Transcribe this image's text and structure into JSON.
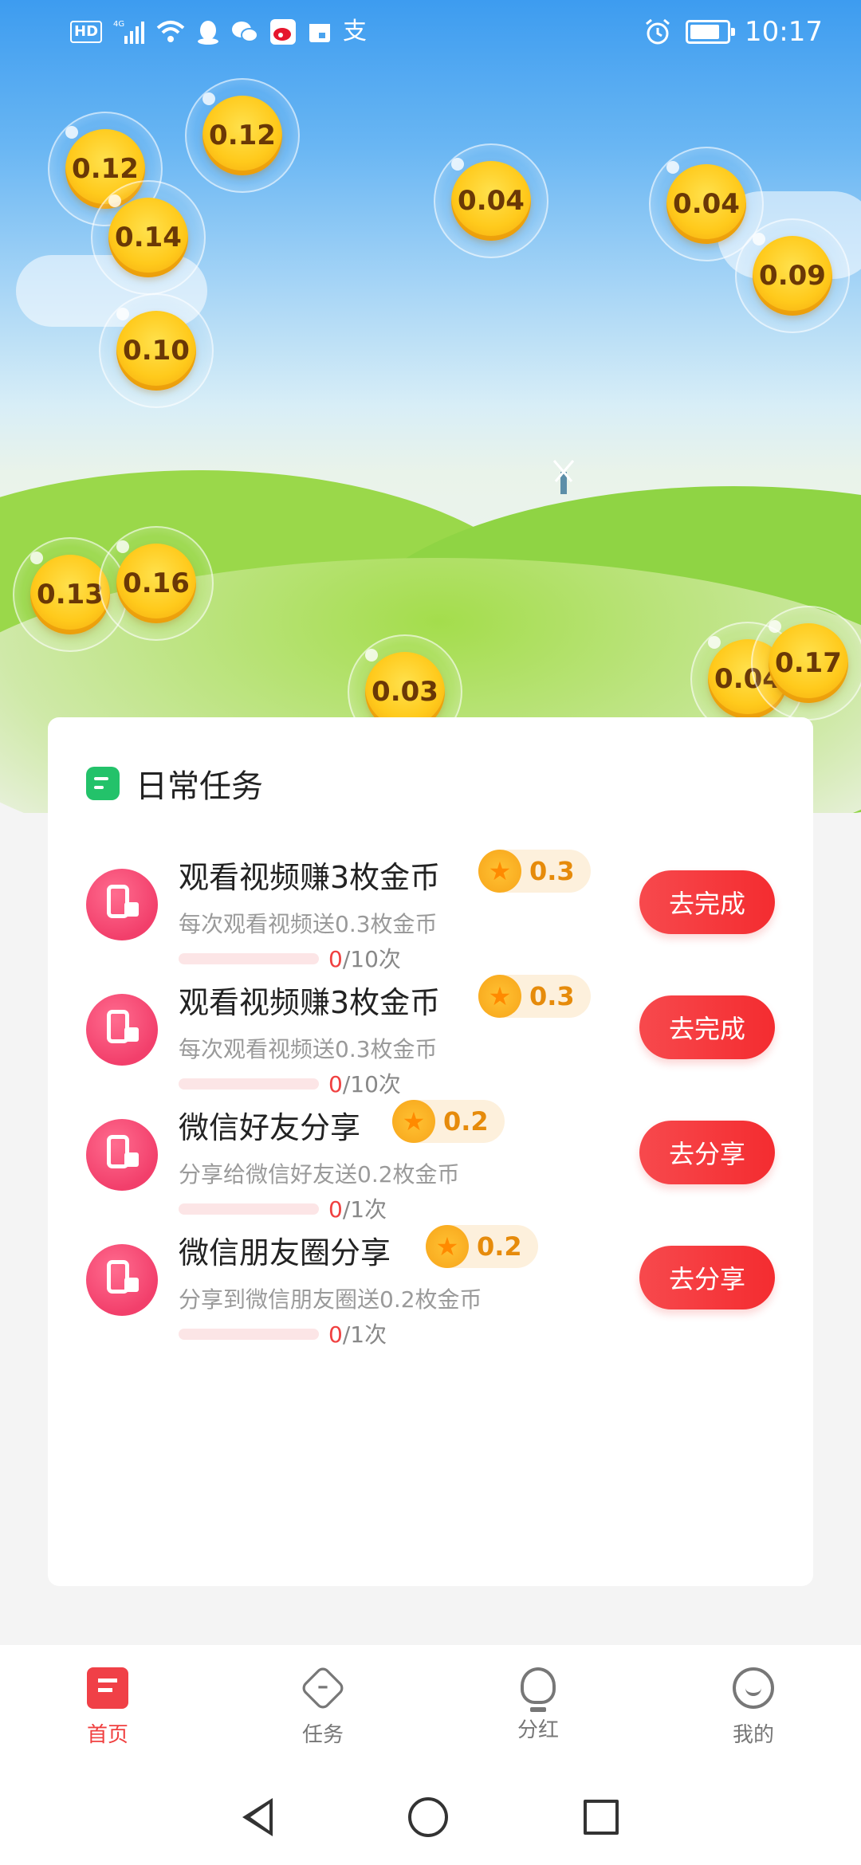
{
  "status_bar": {
    "time": "10:17",
    "left_icons": [
      "hd-icon",
      "signal-4g-icon",
      "wifi-icon",
      "qq-icon",
      "wechat-icon",
      "weibo-icon",
      "calendar-icon",
      "alipay-icon"
    ],
    "right_icons": [
      "alarm-icon",
      "battery-icon"
    ]
  },
  "coins": [
    "0.12",
    "0.12",
    "0.14",
    "0.10",
    "0.04",
    "0.04",
    "0.09",
    "0.13",
    "0.16",
    "0.03",
    "0.04",
    "0.17"
  ],
  "daily_tasks": {
    "title": "日常任务",
    "tasks": [
      {
        "title": "观看视频赚3枚金币",
        "reward": "0.3",
        "desc": "每次观看视频送0.3枚金币",
        "done": "0",
        "total": "/10次",
        "progress": 0,
        "button": "去完成"
      },
      {
        "title": "观看视频赚3枚金币",
        "reward": "0.3",
        "desc": "每次观看视频送0.3枚金币",
        "done": "0",
        "total": "/10次",
        "progress": 0,
        "button": "去完成"
      },
      {
        "title": "微信好友分享",
        "reward": "0.2",
        "desc": "分享给微信好友送0.2枚金币",
        "done": "0",
        "total": "/1次",
        "progress": 0,
        "button": "去分享"
      },
      {
        "title": "微信朋友圈分享",
        "reward": "0.2",
        "desc": "分享到微信朋友圈送0.2枚金币",
        "done": "0",
        "total": "/1次",
        "progress": 0,
        "button": "去分享"
      }
    ]
  },
  "bottom_nav": {
    "items": [
      {
        "label": "首页",
        "icon": "home-icon",
        "active": true
      },
      {
        "label": "任务",
        "icon": "task-icon",
        "active": false
      },
      {
        "label": "分红",
        "icon": "bulb-icon",
        "active": false
      },
      {
        "label": "我的",
        "icon": "profile-icon",
        "active": false
      }
    ]
  },
  "colors": {
    "accent": "#f04040",
    "coin": "#ffc61a",
    "task_icon": "#f23f6b",
    "header_icon": "#23c26a"
  }
}
